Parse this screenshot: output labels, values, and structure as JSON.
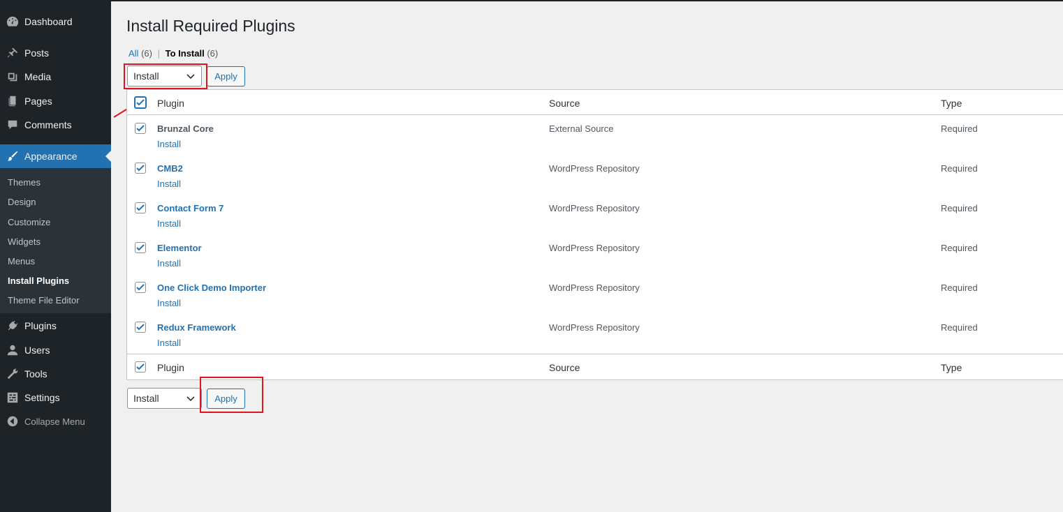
{
  "sidebar": {
    "items": [
      {
        "label": "Dashboard",
        "icon": "dashboard-icon"
      },
      {
        "label": "Posts",
        "icon": "pin-icon"
      },
      {
        "label": "Media",
        "icon": "media-icon"
      },
      {
        "label": "Pages",
        "icon": "pages-icon"
      },
      {
        "label": "Comments",
        "icon": "comment-icon"
      },
      {
        "label": "Appearance",
        "icon": "brush-icon"
      },
      {
        "label": "Plugins",
        "icon": "plug-icon"
      },
      {
        "label": "Users",
        "icon": "user-icon"
      },
      {
        "label": "Tools",
        "icon": "wrench-icon"
      },
      {
        "label": "Settings",
        "icon": "settings-icon"
      }
    ],
    "submenu": [
      "Themes",
      "Design",
      "Customize",
      "Widgets",
      "Menus",
      "Install Plugins",
      "Theme File Editor"
    ],
    "collapse_label": "Collapse Menu",
    "accent": "#2271b1"
  },
  "page": {
    "title": "Install Required Plugins",
    "filters": {
      "all_label": "All",
      "all_count": "(6)",
      "sep": "|",
      "install_label": "To Install",
      "install_count": "(6)"
    },
    "bulk_action": "Install",
    "apply_label": "Apply"
  },
  "table": {
    "columns": [
      "Plugin",
      "Source",
      "Type"
    ],
    "rows": [
      {
        "name": "Brunzal Core",
        "action": "Install",
        "source": "External Source",
        "type": "Required"
      },
      {
        "name": "CMB2",
        "action": "Install",
        "source": "WordPress Repository",
        "type": "Required"
      },
      {
        "name": "Contact Form 7",
        "action": "Install",
        "source": "WordPress Repository",
        "type": "Required"
      },
      {
        "name": "Elementor",
        "action": "Install",
        "source": "WordPress Repository",
        "type": "Required"
      },
      {
        "name": "One Click Demo Importer",
        "action": "Install",
        "source": "WordPress Repository",
        "type": "Required"
      },
      {
        "name": "Redux Framework",
        "action": "Install",
        "source": "WordPress Repository",
        "type": "Required"
      }
    ]
  }
}
